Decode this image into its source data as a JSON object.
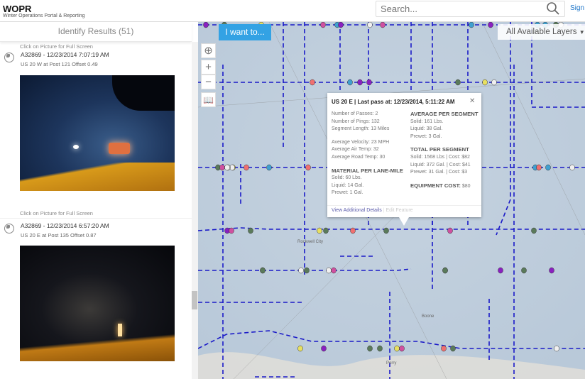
{
  "header": {
    "title": "WOPR",
    "subtitle": "Winter Operations Portal & Reporting",
    "search_placeholder": "Search...",
    "signin": "Sign In"
  },
  "panel": {
    "title": "Identify Results (51)",
    "cut_text": "Click on Picture for Full Screen",
    "items": [
      {
        "title": "A32869 - 12/23/2014 7:07:19 AM",
        "subtitle": "US 20 W at Post 121 Offset 0.49",
        "caption": "Click on Picture for Full Screen"
      },
      {
        "title": "A32869 - 12/23/2014 6:57:20 AM",
        "subtitle": "US 20 E at Post 135 Offset 0.87"
      }
    ]
  },
  "map": {
    "i_want_to": "I want to...",
    "layers": "All Available Layers",
    "labels": [
      "Rockwell City",
      "Boone",
      "Perry"
    ]
  },
  "popup": {
    "title": "US 20 E | Last pass at: 12/23/2014, 5:11:22 AM",
    "left": {
      "stats": [
        "Number of Passes: 2",
        "Number of Pings: 132",
        "Segment Length: 13 Miles"
      ],
      "stats2": [
        "Average Velocity: 23 MPH",
        "Average Air Temp: 32",
        "Average Road Temp: 30"
      ],
      "material_title": "MATERIAL PER LANE-MILE",
      "material": [
        "Solid: 60 Lbs.",
        "Liquid: 14 Gal.",
        "Prewet: 1 Gal."
      ]
    },
    "right": {
      "avg_title": "AVERAGE PER SEGMENT",
      "avg": [
        "Solid: 161 Lbs.",
        "Liquid: 38 Gal.",
        "Prewet: 3 Gal."
      ],
      "total_title": "TOTAL PER SEGMENT",
      "total": [
        "Solid: 1568 Lbs | Cost: $82",
        "Liquid: 372 Gal. | Cost: $41",
        "Prewet: 31 Gal. | Cost: $3"
      ],
      "equip_label": "EQUIPMENT COST:",
      "equip_value": "$80"
    },
    "view_details": "View Additional Details",
    "edit_feature": "Edit Feature"
  },
  "colors": {
    "accent": "#33a2e4",
    "road": "#1a1ac8"
  }
}
